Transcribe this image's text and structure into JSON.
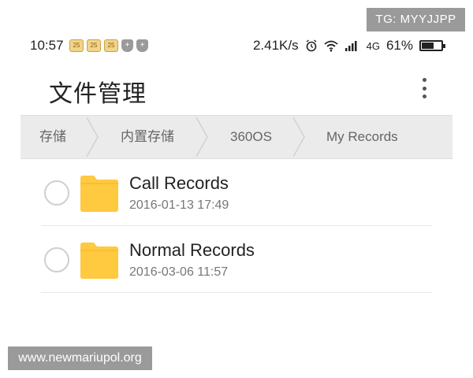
{
  "watermarks": {
    "top": "TG: MYYJJPP",
    "bottom": "www.newmariupol.org"
  },
  "statusbar": {
    "time": "10:57",
    "notification_icons": [
      "25",
      "25",
      "25"
    ],
    "speed": "2.41K/s",
    "network": "4G",
    "battery_percent": "61%",
    "battery_level": 0.61,
    "icons": [
      "calendar-icon",
      "calendar-icon",
      "calendar-icon",
      "shield-icon",
      "shield-icon",
      "alarm-icon",
      "wifi-icon",
      "signal-icon",
      "battery-icon"
    ]
  },
  "appbar": {
    "title": "文件管理",
    "menu_icon": "overflow-menu-icon"
  },
  "breadcrumb": {
    "items": [
      "存储",
      "内置存储",
      "360OS",
      "My Records"
    ]
  },
  "files": [
    {
      "name": "Call Records",
      "date": "2016-01-13 17:49",
      "type": "folder"
    },
    {
      "name": "Normal Records",
      "date": "2016-03-06 11:57",
      "type": "folder"
    }
  ],
  "colors": {
    "folder": "#ffc940",
    "breadcrumb_bg": "#ebebeb",
    "watermark_bg": "#9a9a9a"
  }
}
